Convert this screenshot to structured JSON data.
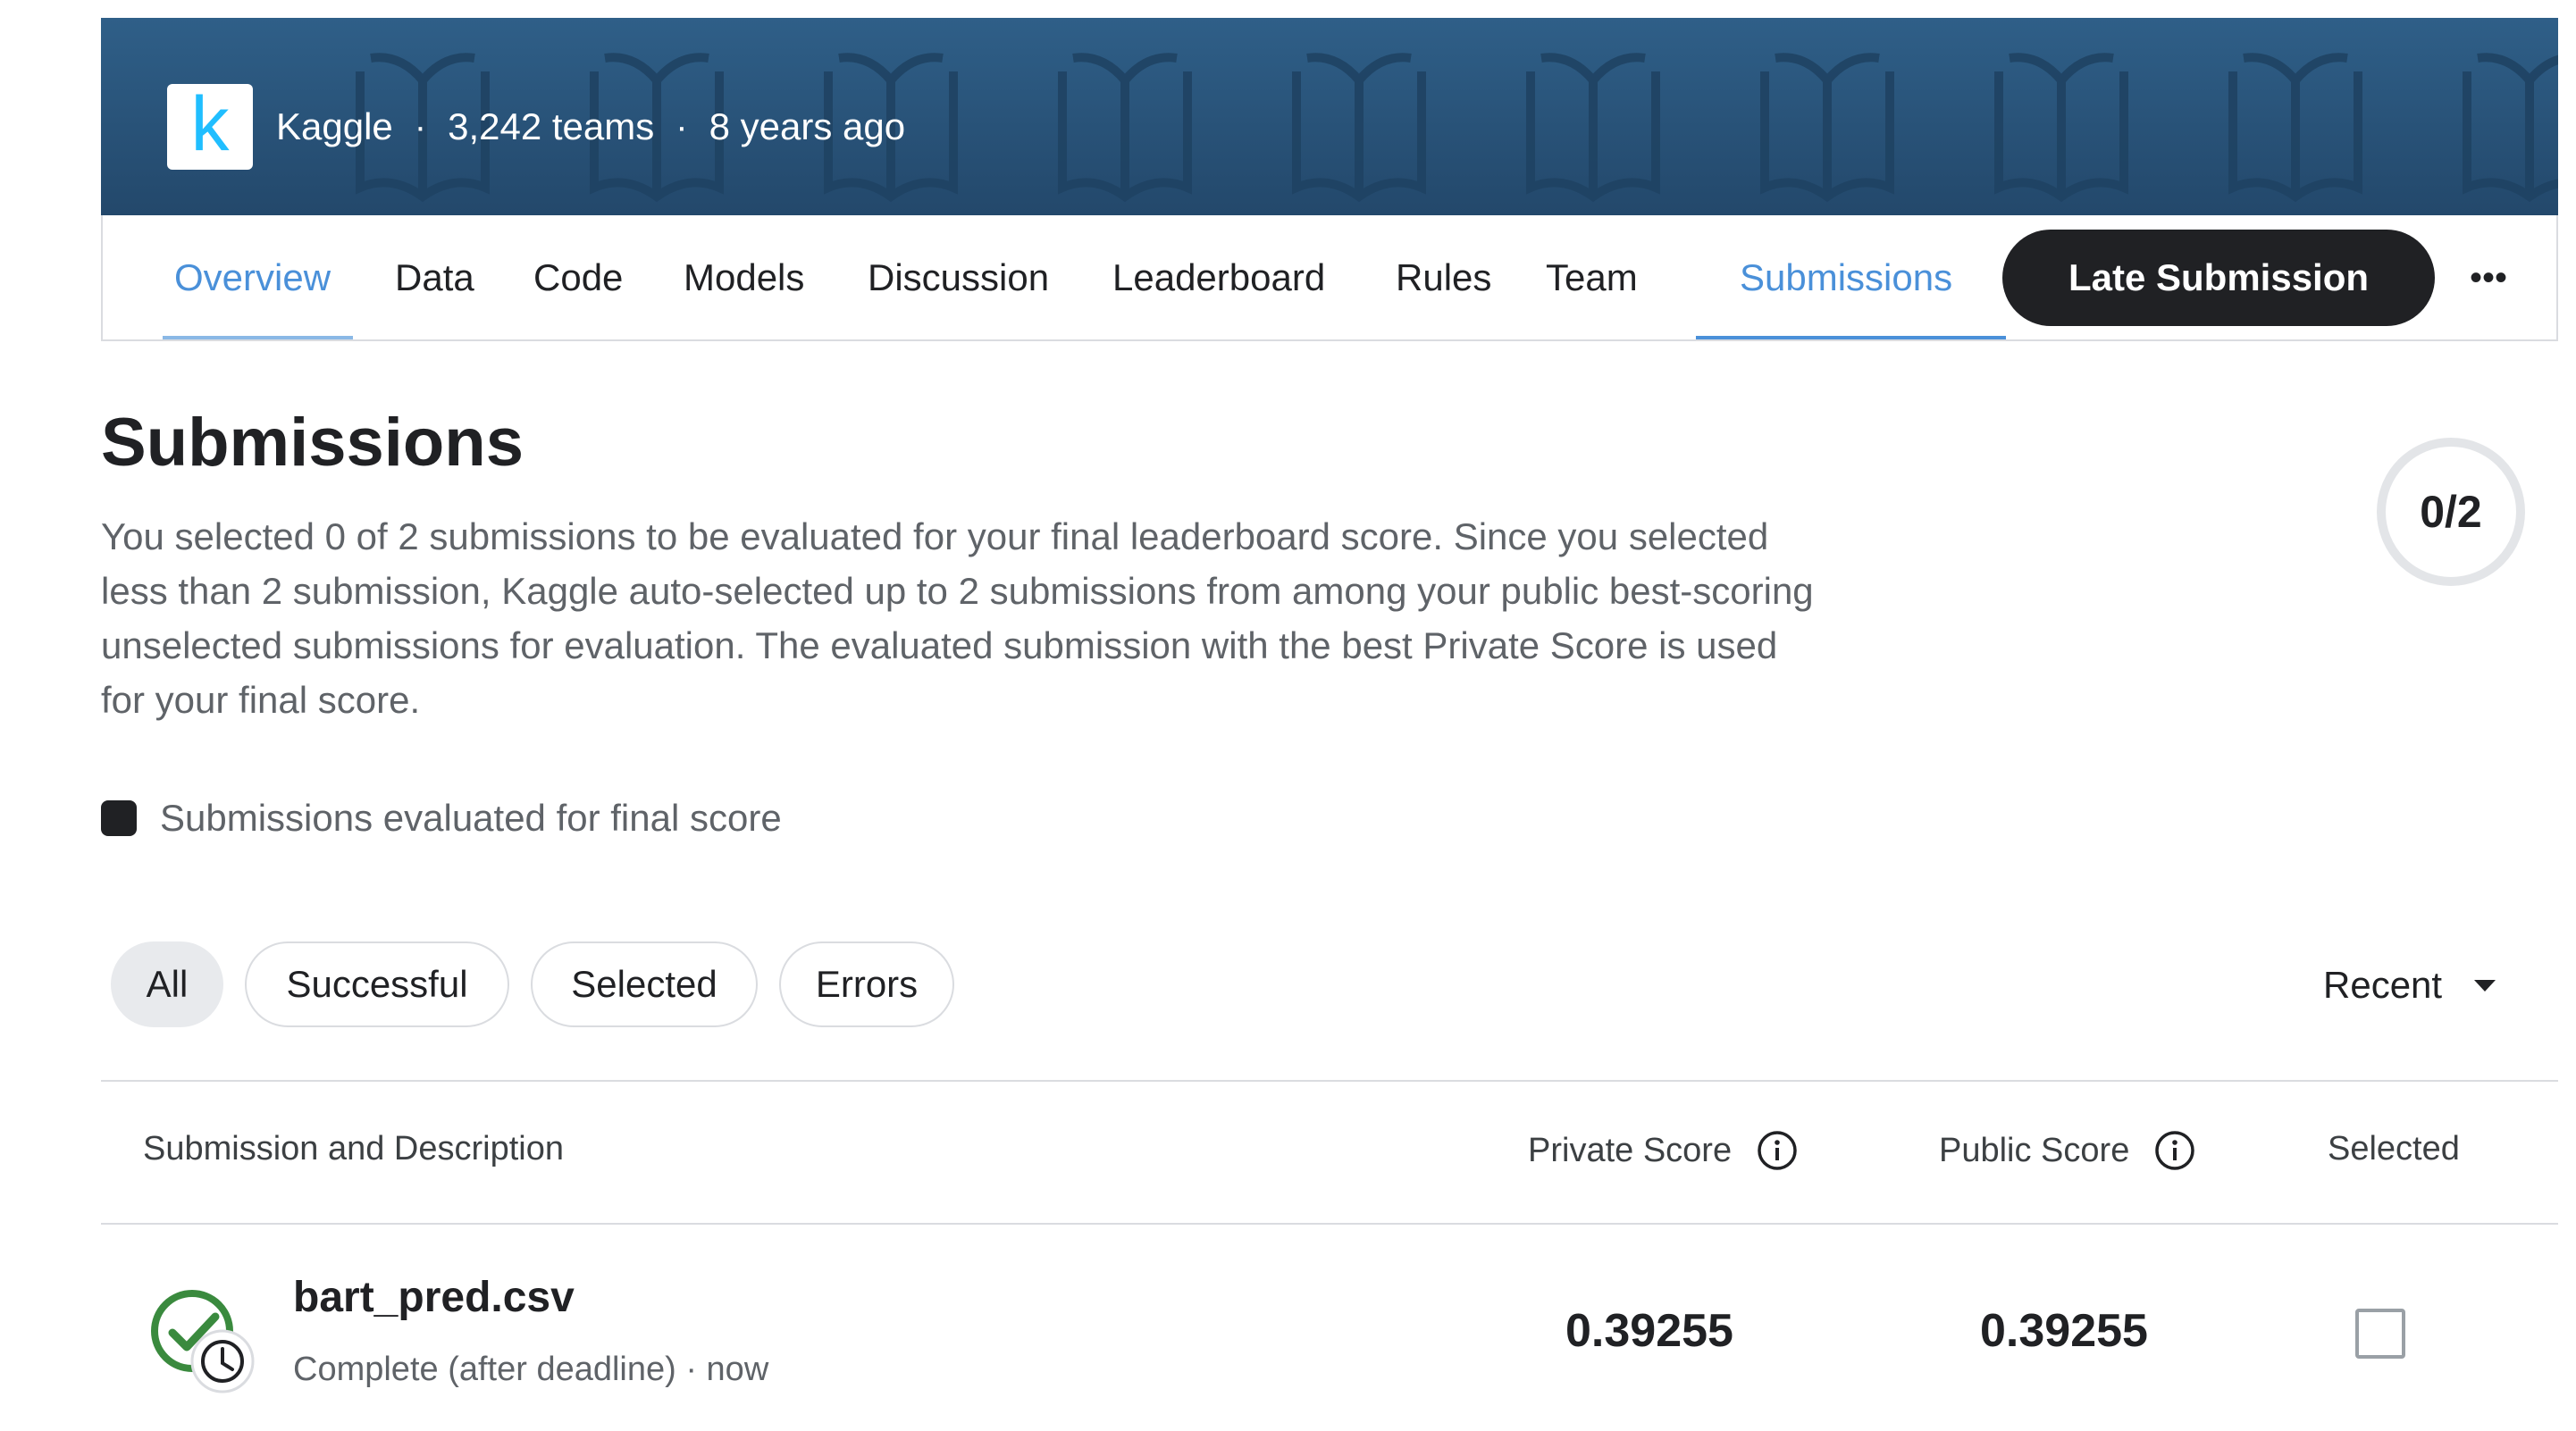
{
  "header": {
    "logo_letter": "k",
    "site": "Kaggle",
    "teams": "3,242 teams",
    "age": "8 years ago",
    "separator": "·"
  },
  "tabs": [
    {
      "label": "Overview"
    },
    {
      "label": "Data"
    },
    {
      "label": "Code"
    },
    {
      "label": "Models"
    },
    {
      "label": "Discussion"
    },
    {
      "label": "Leaderboard"
    },
    {
      "label": "Rules"
    },
    {
      "label": "Team"
    },
    {
      "label": "Submissions"
    }
  ],
  "late_submission_label": "Late Submission",
  "more_label": "•••",
  "page": {
    "title": "Submissions",
    "description": "You selected 0 of 2 submissions to be evaluated for your final leaderboard score. Since you selected less than 2 submission, Kaggle auto-selected up to 2 submissions from among your public best-scoring unselected submissions for evaluation. The evaluated submission with the best Private Score is used for your final score.",
    "selection_count": "0/2",
    "legend_label": "Submissions evaluated for final score"
  },
  "filters": {
    "chips": [
      {
        "label": "All"
      },
      {
        "label": "Successful"
      },
      {
        "label": "Selected"
      },
      {
        "label": "Errors"
      }
    ],
    "sort": "Recent"
  },
  "table": {
    "headers": {
      "submission": "Submission and Description",
      "private": "Private Score",
      "public": "Public Score",
      "selected": "Selected"
    },
    "rows": [
      {
        "file": "bart_pred.csv",
        "status": "Complete (after deadline) · now",
        "private_score": "0.39255",
        "public_score": "0.39255",
        "selected": false
      }
    ]
  },
  "colors": {
    "accent_blue": "#4a90d9",
    "header_bg": "#2a5479",
    "success_green": "#3a8a3e",
    "button_dark": "#202124"
  }
}
